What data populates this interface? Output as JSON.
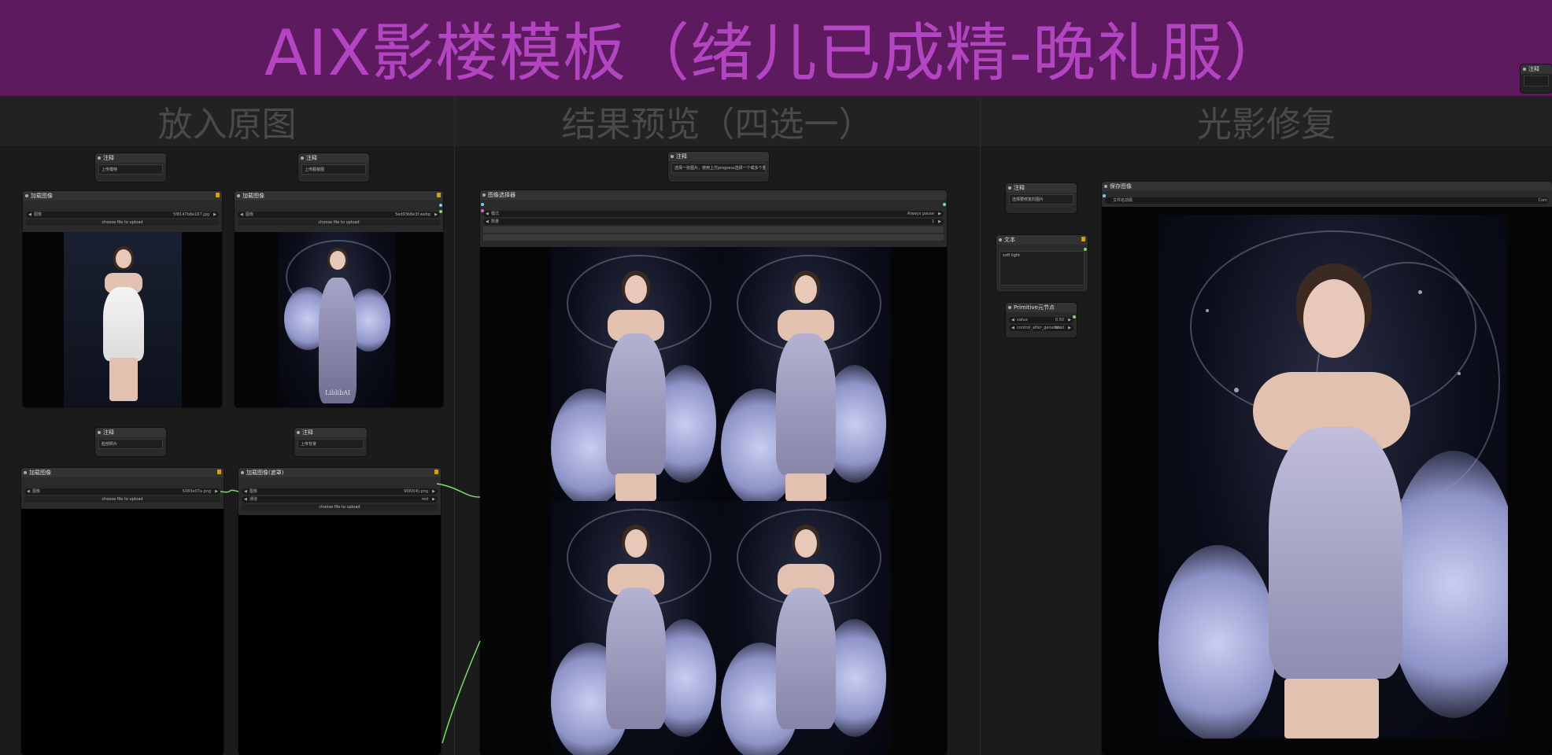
{
  "banner": {
    "title": "AIX影楼模板（绪儿已成精-晚礼服）"
  },
  "groups": [
    {
      "title": "放入原图"
    },
    {
      "title": "结果预览（四选一）"
    },
    {
      "title": "光影修复"
    }
  ],
  "nodes": {
    "note1": {
      "title": "注释",
      "body": "上传模特"
    },
    "note2": {
      "title": "注释",
      "body": "上传服装图"
    },
    "note3": {
      "title": "注释",
      "body": "脸部照片"
    },
    "note4": {
      "title": "注释",
      "body": "上传背景"
    },
    "note_preview": {
      "title": "注释",
      "body": "选择一张图片，使用上方progress选择一个或多个重新生成"
    },
    "note_relight": {
      "title": "注释",
      "body": "选择要修复的图片"
    },
    "note_corner": {
      "title": "注释",
      "body": ""
    },
    "load1": {
      "title": "加载图像",
      "file_label": "图像",
      "file_value": "5f8147b8e167.jpg",
      "upload": "choose file to upload"
    },
    "load2": {
      "title": "加载图像",
      "file_label": "图像",
      "file_value": "5ed93b8e3f.webp",
      "upload": "choose file to upload",
      "watermark": "LiblibAI"
    },
    "load3": {
      "title": "加载图像",
      "file_label": "图像",
      "file_value": "5083e07a.png",
      "upload": "choose file to upload"
    },
    "load4": {
      "title": "加载图像(遮罩)",
      "file_label": "图像",
      "file_value": "9060(4).png",
      "channel_label": "通道",
      "channel_value": "red",
      "upload": "choose file to upload"
    },
    "preview": {
      "title": "图像选择器",
      "mode_label": "模式",
      "mode_value": "Always pause",
      "count_label": "数量",
      "count_value": "1"
    },
    "text": {
      "title": "文本",
      "body": "soft light"
    },
    "primitive": {
      "title": "Primitive元节点",
      "value_label": "value",
      "value_value": "0.50",
      "control_label": "control_after_generate",
      "control_value": "fixed"
    },
    "output": {
      "title": "保存图像",
      "prefix_label": "文件名前缀",
      "prefix_value": "Com"
    }
  },
  "colors": {
    "banner_bg": "#5e1a5e",
    "banner_text": "#b445c2",
    "link_green": "#7cdc6a",
    "lock": "#d4a017"
  }
}
